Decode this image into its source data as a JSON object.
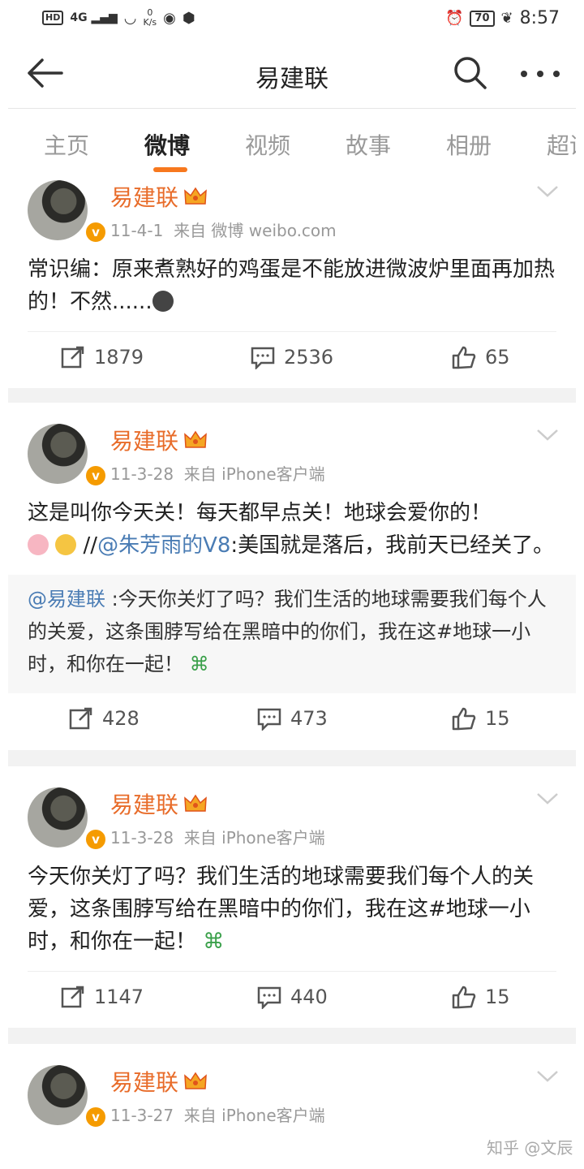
{
  "status_bar": {
    "hd": "HD",
    "signal": "4G",
    "speed_value": "0",
    "speed_unit": "K/s",
    "battery": "70",
    "time": "8:57"
  },
  "header": {
    "title": "易建联"
  },
  "tabs": [
    {
      "label": "主页",
      "active": false
    },
    {
      "label": "微博",
      "active": true
    },
    {
      "label": "视频",
      "active": false
    },
    {
      "label": "故事",
      "active": false
    },
    {
      "label": "相册",
      "active": false
    },
    {
      "label": "超话",
      "active": false
    }
  ],
  "posts": [
    {
      "author": "易建联",
      "date": "11-4-1",
      "source": "来自 微博 weibo.com",
      "text": "常识编：原来煮熟好的鸡蛋是不能放进微波炉里面再加热的！不然......",
      "reposts": "1879",
      "comments": "2536",
      "likes": "65"
    },
    {
      "author": "易建联",
      "date": "11-3-28",
      "source": "来自 iPhone客户端",
      "text": "这是叫你今天关！每天都早点关！地球会爱你的！",
      "text_separator": " //",
      "mention": "@朱芳雨的V8",
      "text_after": ":美国就是落后，我前天已经关了。",
      "repost_mention": "@易建联",
      "repost_text": " :今天你关灯了吗？我们生活的地球需要我们每个人的关爱，这条围脖写给在黑暗中的你们，我在这#地球一小时，和你在一起！",
      "reposts": "428",
      "comments": "473",
      "likes": "15"
    },
    {
      "author": "易建联",
      "date": "11-3-28",
      "source": "来自 iPhone客户端",
      "text": "今天你关灯了吗？我们生活的地球需要我们每个人的关爱，这条围脖写给在黑暗中的你们，我在这#地球一小时，和你在一起！",
      "reposts": "1147",
      "comments": "440",
      "likes": "15"
    },
    {
      "author": "易建联",
      "date": "11-3-27",
      "source": "来自 iPhone客户端"
    }
  ],
  "watermark": "知乎 @文辰",
  "colors": {
    "accent": "#f7781e",
    "username": "#e86c2a",
    "mention": "#4a7cb4",
    "vbadge": "#f59b00"
  }
}
